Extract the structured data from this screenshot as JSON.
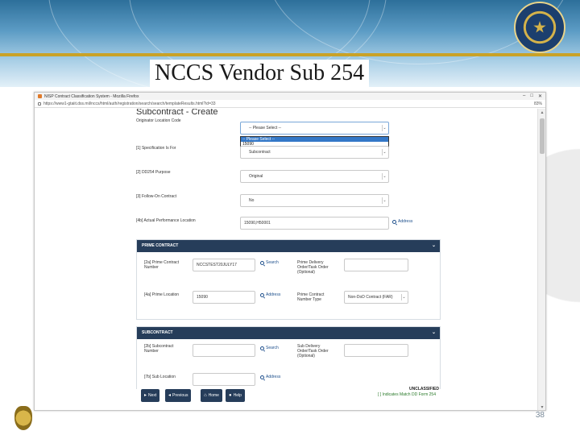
{
  "slide": {
    "title": "NCCS Vendor Sub 254",
    "page_number": "38",
    "colors": {
      "header_blue": "#2d6f9a",
      "gold": "#c9a227",
      "panel_navy": "#263d5a"
    }
  },
  "browser": {
    "window_title": "NISP Contract Classification System - Mozilla Firefox",
    "url": "https://www1-gtaiit.dss.mil/nccs/html/auth/registration/search/search/templateResults.html?id=33",
    "zoom": "83%"
  },
  "form": {
    "heading": "Subcontract - Create",
    "originator_location": {
      "label": "Originator Location Code",
      "value": "-- Please Select --",
      "options": [
        "-- Please Select --",
        "15090"
      ]
    },
    "specification_for": {
      "label": "[1] Specification Is For",
      "value": "Subcontract"
    },
    "dd254_purpose": {
      "label": "[2] DD254 Purpose",
      "value": "Original"
    },
    "follow_on": {
      "label": "[3] Follow-On Contract",
      "value": "No"
    },
    "actual_performance": {
      "label": "[4b] Actual Performance Location",
      "value": "15090,H50001",
      "link": "Address"
    }
  },
  "prime_contract": {
    "header": "PRIME CONTRACT",
    "number": {
      "label": "[2a] Prime Contract Number",
      "value": "NCCSTEST20JULY17",
      "link": "Search"
    },
    "delivery_order": {
      "label": "Prime Delivery Order/Task Order (Optional)",
      "value": ""
    },
    "location": {
      "label": "[4a] Prime Location",
      "value": "15090",
      "link": "Address"
    },
    "contract_type": {
      "label": "Prime Contract Number Type",
      "value": "Non-DoD Contract (FAR)"
    }
  },
  "subcontract": {
    "header": "SUBCONTRACT",
    "number": {
      "label": "[2b] Subcontract Number",
      "value": "",
      "link": "Search"
    },
    "delivery_order": {
      "label": "Sub Delivery Order/Task Order (Optional)",
      "value": ""
    },
    "location": {
      "label": "[7b] Sub Location",
      "value": "",
      "link": "Address"
    }
  },
  "footer": {
    "next": "Next",
    "previous": "Previous",
    "home": "Home",
    "help": "Help",
    "classification": "UNCLASSIFIED",
    "dd254_note": "[ ] Indicates Match DD Form 254"
  }
}
